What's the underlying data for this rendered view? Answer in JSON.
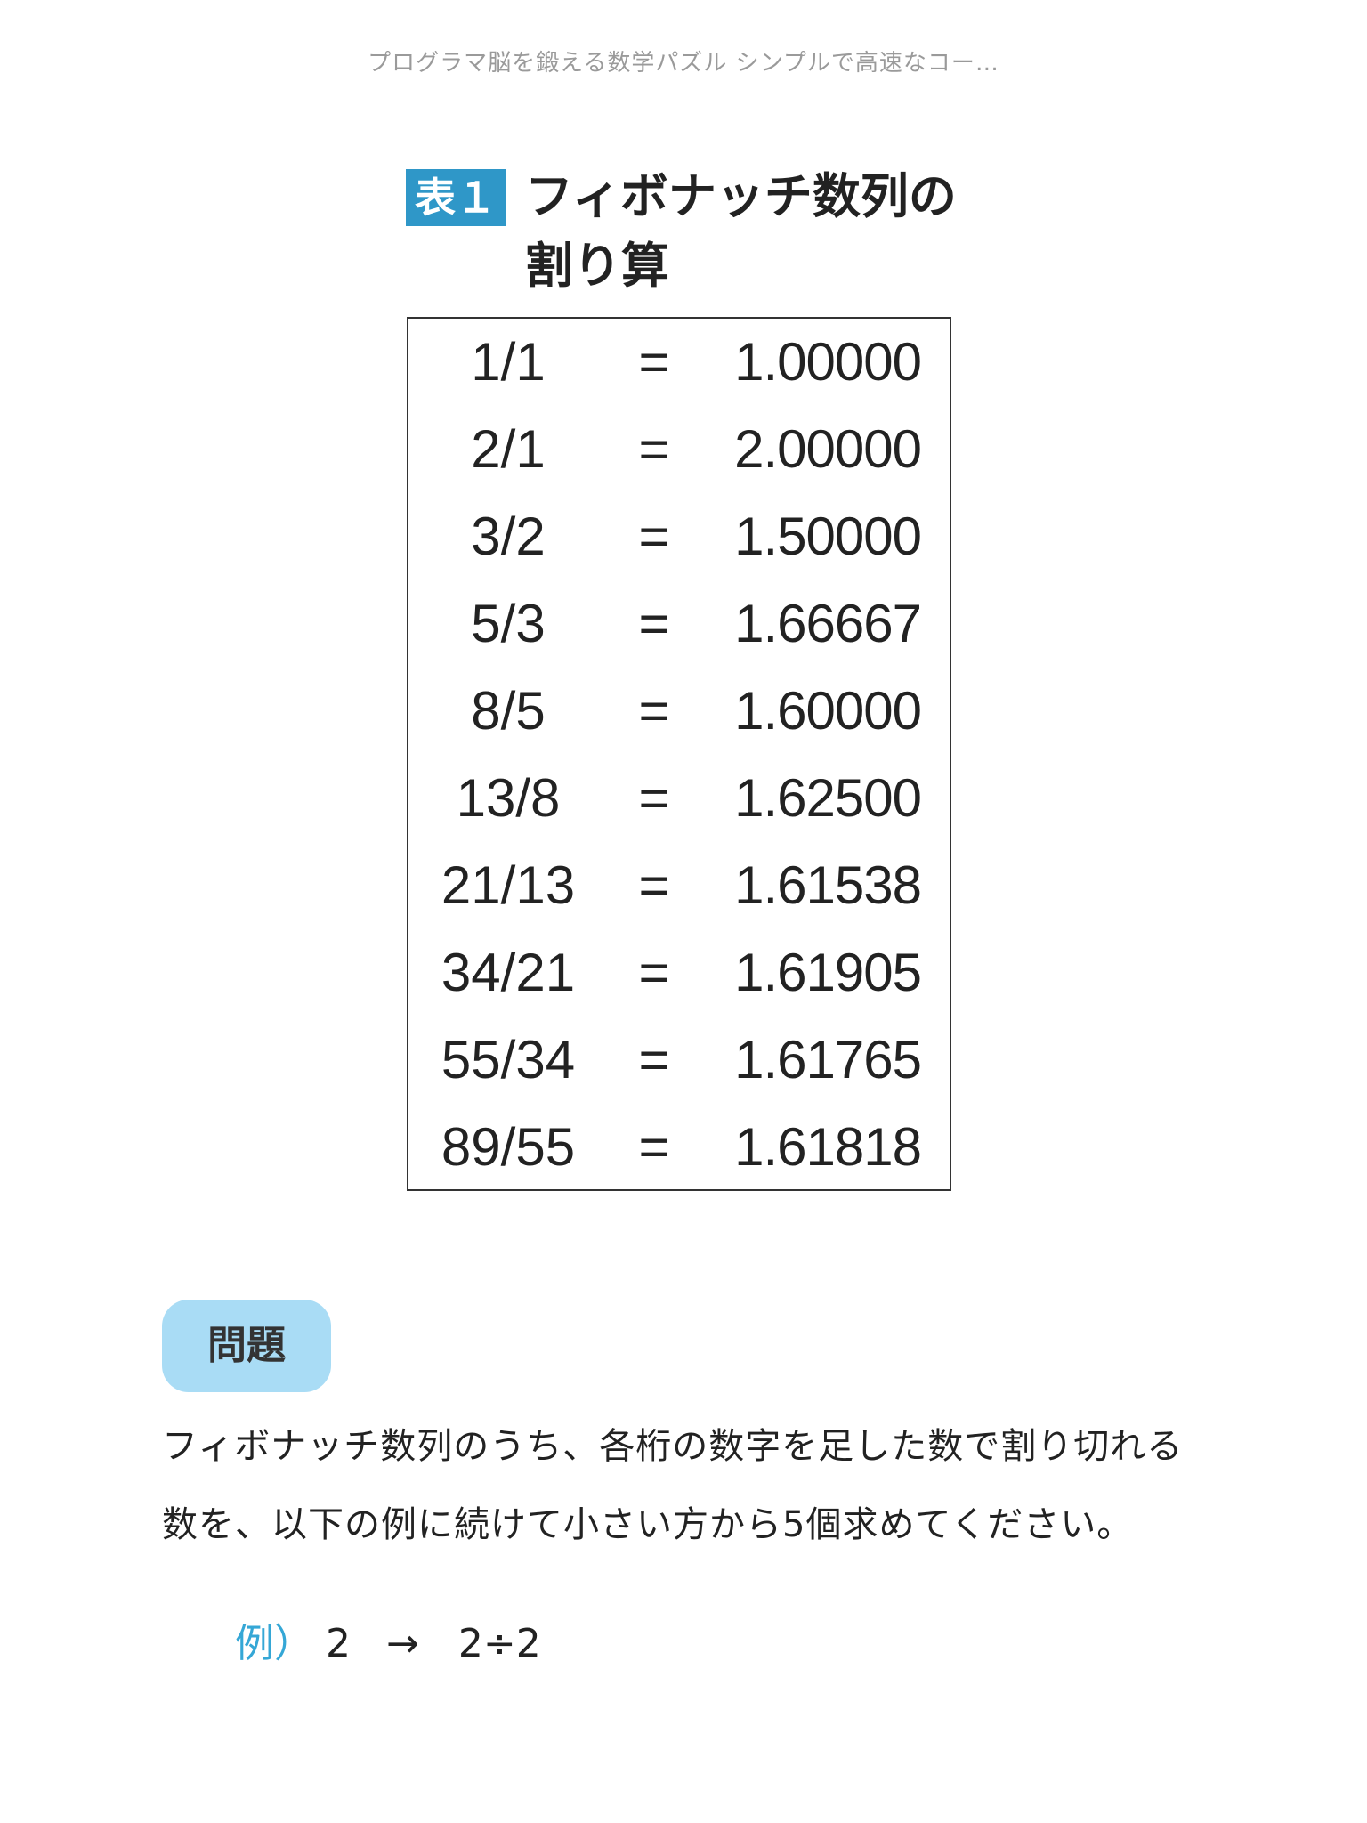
{
  "header": {
    "title": "プログラマ脳を鍛える数学パズル シンプルで高速なコー…"
  },
  "table_caption": {
    "badge": "表１",
    "line1": "フィボナッチ数列の",
    "line2": "割り算"
  },
  "fib_table": {
    "rows": [
      {
        "fraction": "1/1",
        "equals": "=",
        "value": "1.00000"
      },
      {
        "fraction": "2/1",
        "equals": "=",
        "value": "2.00000"
      },
      {
        "fraction": "3/2",
        "equals": "=",
        "value": "1.50000"
      },
      {
        "fraction": "5/3",
        "equals": "=",
        "value": "1.66667"
      },
      {
        "fraction": "8/5",
        "equals": "=",
        "value": "1.60000"
      },
      {
        "fraction": "13/8",
        "equals": "=",
        "value": "1.62500"
      },
      {
        "fraction": "21/13",
        "equals": "=",
        "value": "1.61538"
      },
      {
        "fraction": "34/21",
        "equals": "=",
        "value": "1.61905"
      },
      {
        "fraction": "55/34",
        "equals": "=",
        "value": "1.61765"
      },
      {
        "fraction": "89/55",
        "equals": "=",
        "value": "1.61818"
      }
    ]
  },
  "problem": {
    "badge": "問題",
    "line1": "フィボナッチ数列のうち、各桁の数字を足した数で割り切れる",
    "line2": "数を、以下の例に続けて小さい方から5個求めてください。"
  },
  "example": {
    "label": "例）",
    "number": "2",
    "arrow": "→",
    "expression": "2÷2"
  },
  "colors": {
    "badge_blue": "#2f97c8",
    "problem_badge_bg": "#a9dcf5",
    "example_label": "#35a7d6"
  }
}
